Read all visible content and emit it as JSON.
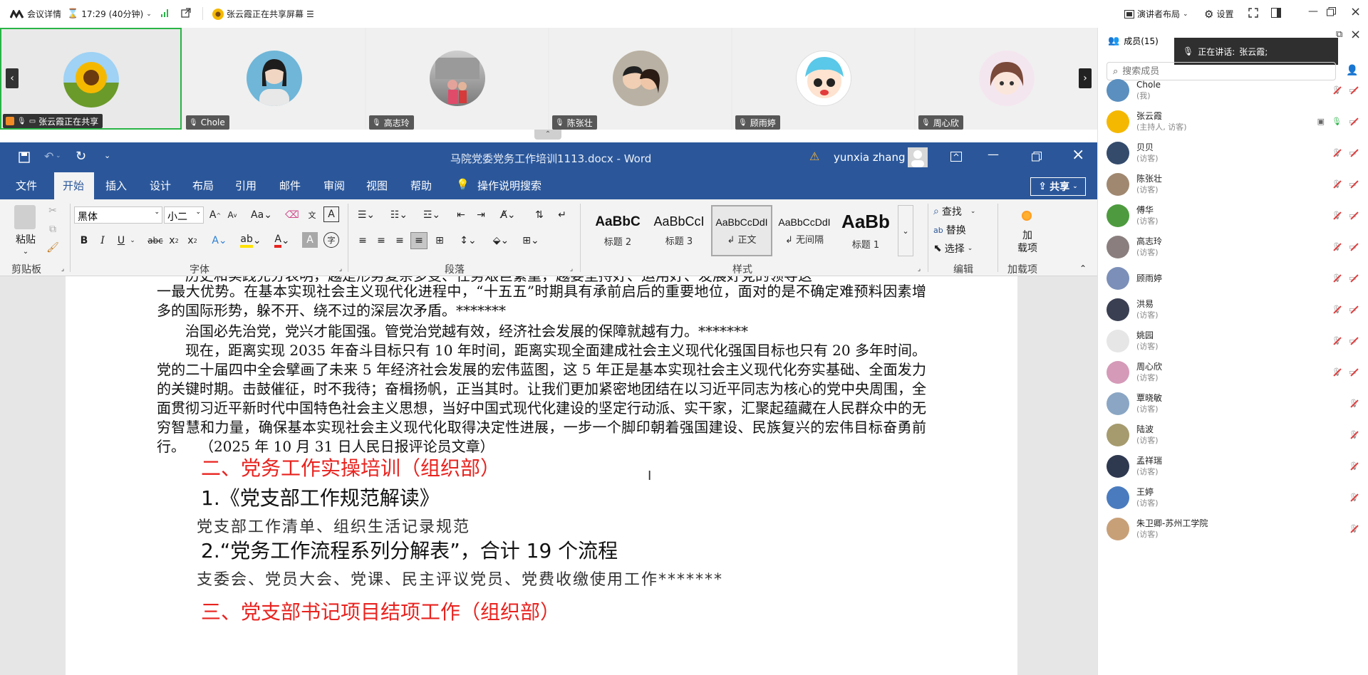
{
  "topbar": {
    "meeting_details": "会议详情",
    "time": "17:29 (40分钟)",
    "sharing_status": "张云霞正在共享屏幕",
    "layout": "演讲者布局",
    "settings": "设置"
  },
  "video_strip": {
    "tiles": [
      {
        "name": "张云霞正在共享"
      },
      {
        "name": "Chole"
      },
      {
        "name": "高志玲"
      },
      {
        "name": "陈张壮"
      },
      {
        "name": "顾雨婷"
      },
      {
        "name": "周心欣"
      }
    ]
  },
  "word": {
    "doc_title": "马院党委党务工作培训1113.docx  -  Word",
    "user": "yunxia zhang",
    "tabs": [
      "文件",
      "开始",
      "插入",
      "设计",
      "布局",
      "引用",
      "邮件",
      "审阅",
      "视图",
      "帮助"
    ],
    "active_tab": "开始",
    "tell_me": "操作说明搜索",
    "share": "共享",
    "ribbon": {
      "paste": "粘贴",
      "clipboard": "剪贴板",
      "font_name": "黑体",
      "font_size": "小二",
      "font_group": "字体",
      "paragraph_group": "段落",
      "styles_group": "样式",
      "editing_group": "编辑",
      "addins_group": "加载项",
      "find": "查找",
      "replace": "替换",
      "select": "选择",
      "addins": "加\n载项",
      "styles": [
        {
          "preview": "AaBbC",
          "name": "标题 2"
        },
        {
          "preview": "AaBbCcI",
          "name": "标题 3"
        },
        {
          "preview": "AaBbCcDdI",
          "name": "↲ 正文"
        },
        {
          "preview": "AaBbCcDdI",
          "name": "↲ 无间隔"
        },
        {
          "preview": "AaBb",
          "name": "标题 1"
        }
      ]
    },
    "document": {
      "p0": "历史和实践充分表明，越是形势复杂多变、任务艰巨繁重，越要坚持好、运用好、发展好党的领导这",
      "p1": "一最大优势。在基本实现社会主义现代化进程中，“十五五”时期具有承前启后的重要地位，面对的是不确定难预料因素增多的国际形势，躲不开、绕不过的深层次矛盾。*******",
      "p2": "治国必先治党，党兴才能国强。管党治党越有效，经济社会发展的保障就越有力。*******",
      "p3": "现在，距离实现 2035 年奋斗目标只有 10 年时间，距离实现全面建成社会主义现代化强国目标也只有 20 多年时间。党的二十届四中全会擘画了未来 5 年经济社会发展的宏伟蓝图，这 5 年正是基本实现社会主义现代化夯实基础、全面发力的关键时期。击鼓催征，时不我待；奋楫扬帆，正当其时。让我们更加紧密地团结在以习近平同志为核心的党中央周围，全面贯彻习近平新时代中国特色社会主义思想，当好中国式现代化建设的坚定行动派、实干家，汇聚起蕴藏在人民群众中的无穷智慧和力量，确保基本实现社会主义现代化取得决定性进展，一步一个脚印朝着强国建设、民族复兴的宏伟目标奋勇前行。　　（2025 年 10 月 31 日人民日报评论员文章）",
      "h2": "二、党务工作实操培训（组织部）",
      "item1": "1.《党支部工作规范解读》",
      "item1_sub": "党支部工作清单、组织生活记录规范",
      "item2": "2.“党务工作流程系列分解表”，合计 19 个流程",
      "item2_sub": "支委会、党员大会、党课、民主评议党员、党费收缴使用工作*******",
      "h3": "三、党支部书记项目结项工作（组织部）"
    }
  },
  "members_panel": {
    "title": "成员(15)",
    "speaking_label": "正在讲话:",
    "speaking_name": "张云霞;",
    "search_placeholder": "搜索成员",
    "members": [
      {
        "name": "Chole",
        "role": "(我)"
      },
      {
        "name": "张云霞",
        "role": "(主持人, 访客)"
      },
      {
        "name": "贝贝",
        "role": "(访客)"
      },
      {
        "name": "陈张壮",
        "role": "(访客)"
      },
      {
        "name": "傅华",
        "role": "(访客)"
      },
      {
        "name": "高志玲",
        "role": "(访客)"
      },
      {
        "name": "顾雨婷",
        "role": ""
      },
      {
        "name": "洪易",
        "role": "(访客)"
      },
      {
        "name": "姚园",
        "role": "(访客)"
      },
      {
        "name": "周心欣",
        "role": "(访客)"
      },
      {
        "name": "覃晓敏",
        "role": "(访客)"
      },
      {
        "name": "陆波",
        "role": "(访客)"
      },
      {
        "name": "孟祥瑞",
        "role": "(访客)"
      },
      {
        "name": "王婷",
        "role": "(访客)"
      },
      {
        "name": "朱卫卿-苏州工学院",
        "role": "(访客)"
      }
    ]
  },
  "colors": {
    "word_blue": "#2b579a",
    "heading_red": "#e8231f",
    "mute_red": "#e23b3b",
    "active_green": "#28b446"
  }
}
